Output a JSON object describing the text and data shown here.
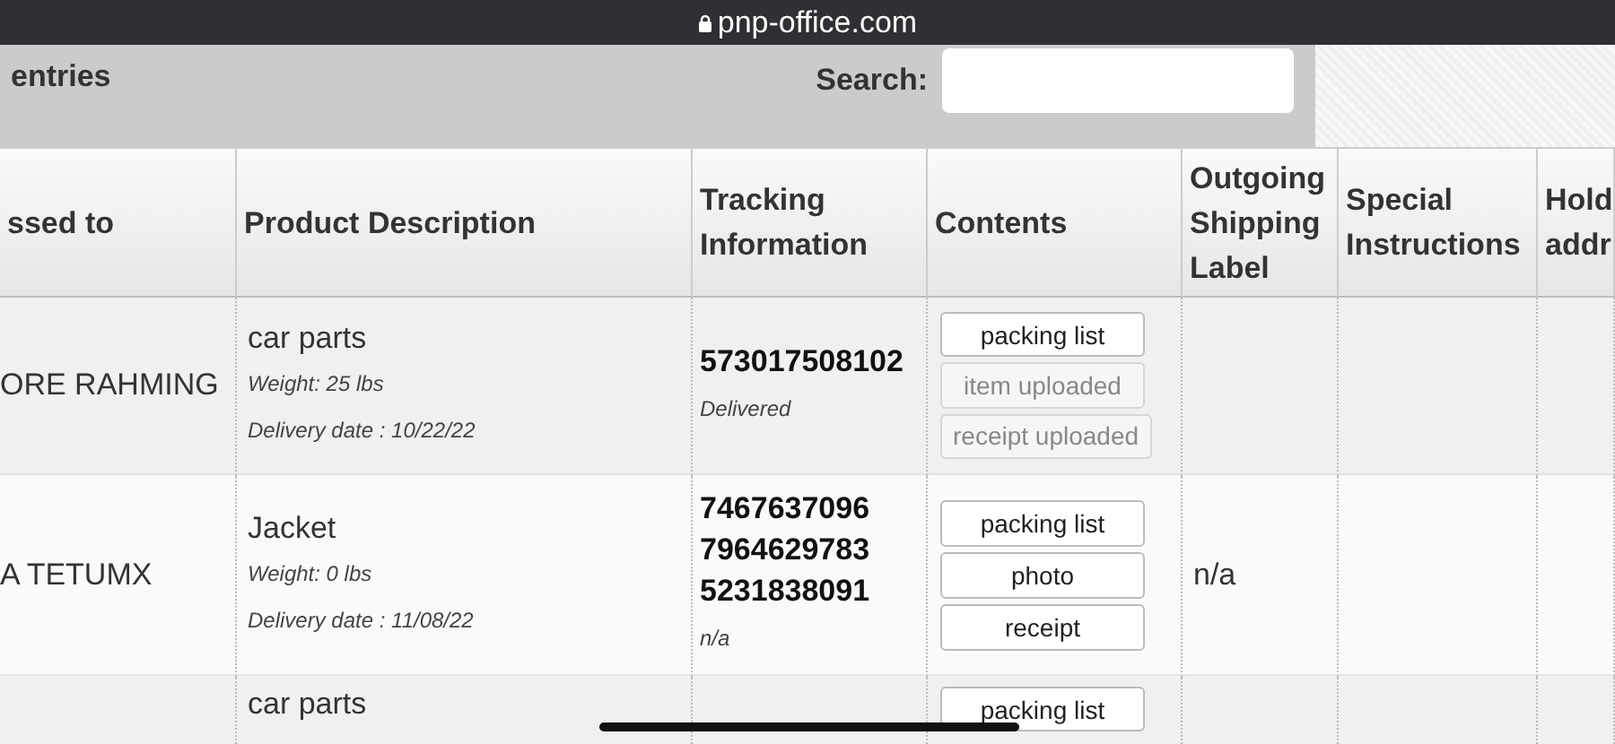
{
  "address_bar": {
    "url": "pnp-office.com"
  },
  "controls": {
    "entries_label": "entries",
    "search_label": "Search:"
  },
  "table": {
    "columns": [
      "ssed to",
      "Product Description",
      "Tracking Information",
      "Contents",
      "Outgoing Shipping Label",
      "Special Instructions",
      "Hold addr"
    ],
    "rows": [
      {
        "addressed_to": "ORE RAHMING",
        "product": "car parts",
        "weight": "Weight: 25 lbs",
        "delivery": "Delivery date : 10/22/22",
        "tracking_numbers": [
          "573017508102"
        ],
        "tracking_status": "Delivered",
        "contents": [
          {
            "label": "packing list",
            "disabled": false
          },
          {
            "label": "item uploaded",
            "disabled": true
          },
          {
            "label": "receipt uploaded",
            "disabled": true
          }
        ],
        "shipping_label": ""
      },
      {
        "addressed_to": "A TETUMX",
        "product": "Jacket",
        "weight": "Weight: 0 lbs",
        "delivery": "Delivery date : 11/08/22",
        "tracking_numbers": [
          "7467637096",
          "7964629783",
          "5231838091"
        ],
        "tracking_status": "n/a",
        "contents": [
          {
            "label": "packing list",
            "disabled": false
          },
          {
            "label": "photo",
            "disabled": false
          },
          {
            "label": "receipt",
            "disabled": false
          }
        ],
        "shipping_label": "n/a"
      },
      {
        "addressed_to": "",
        "product": "car parts",
        "contents": [
          {
            "label": "packing list",
            "disabled": false
          }
        ]
      }
    ]
  }
}
